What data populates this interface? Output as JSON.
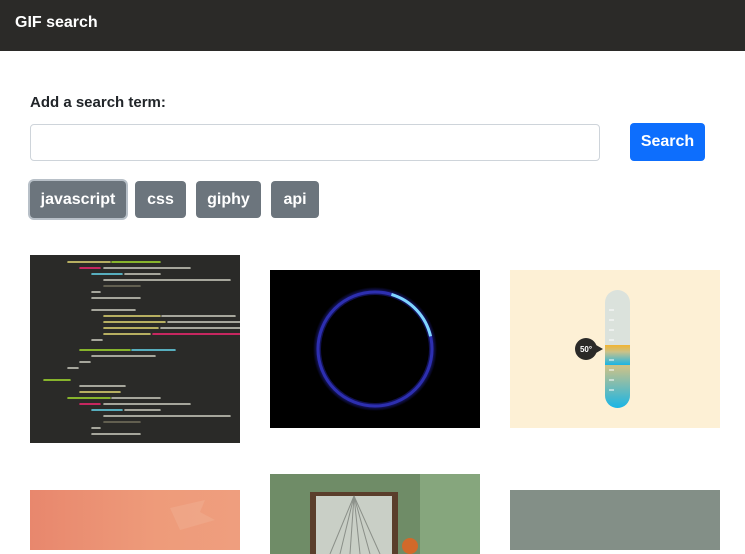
{
  "navbar": {
    "title": "GIF search"
  },
  "search": {
    "label": "Add a search term:",
    "value": "",
    "placeholder": "",
    "button_label": "Search"
  },
  "tags": [
    {
      "label": "javascript",
      "active": true
    },
    {
      "label": "css",
      "active": false
    },
    {
      "label": "giphy",
      "active": false
    },
    {
      "label": "api",
      "active": false
    }
  ],
  "gifs": {
    "code": {
      "icon": "code-screenshot-gif"
    },
    "ring": {
      "icon": "eclipse-ring-gif"
    },
    "thermometer": {
      "icon": "thermometer-gif",
      "reading": "50°"
    },
    "coral": {
      "icon": "coral-abstract-gif"
    },
    "room": {
      "icon": "room-window-gif"
    },
    "grey": {
      "icon": "grey-scene-gif"
    }
  },
  "colors": {
    "navbar": "#2b2a28",
    "primary": "#0d6efd",
    "tag": "#6c757d"
  }
}
